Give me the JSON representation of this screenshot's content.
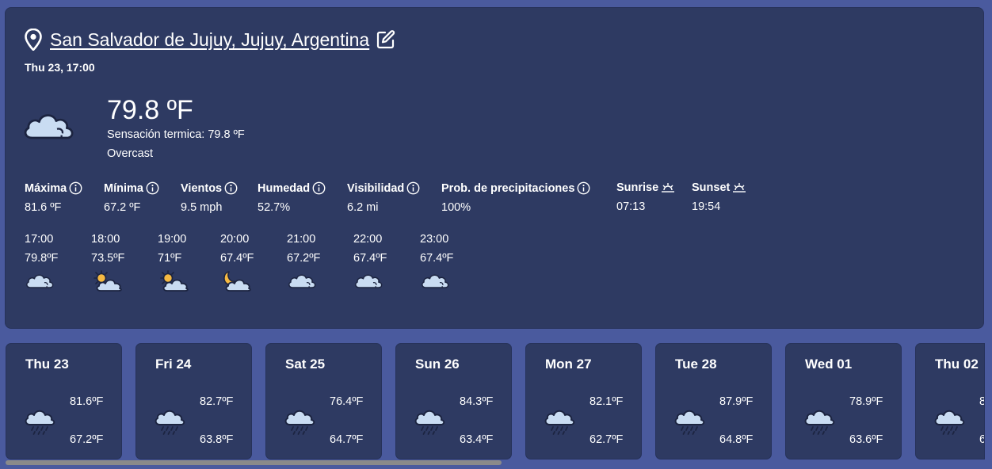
{
  "location": {
    "name": "San Salvador de Jujuy, Jujuy, Argentina"
  },
  "datetime": "Thu 23, 17:00",
  "current": {
    "temp": "79.8 ºF",
    "feels_like": "Sensación termica: 79.8 ºF",
    "condition": "Overcast",
    "icon": "cloud-icon"
  },
  "stats": [
    {
      "label": "Máxima",
      "value": "81.6 ºF",
      "icon": "info-icon"
    },
    {
      "label": "Mínima",
      "value": "67.2 ºF",
      "icon": "info-icon"
    },
    {
      "label": "Vientos",
      "value": "9.5 mph",
      "icon": "info-icon"
    },
    {
      "label": "Humedad",
      "value": "52.7%",
      "icon": "info-icon"
    },
    {
      "label": "Visibilidad",
      "value": "6.2 mi",
      "icon": "info-icon"
    },
    {
      "label": "Prob. de precipitaciones",
      "value": "100%",
      "icon": "info-icon"
    },
    {
      "label": "Sunrise",
      "value": "07:13",
      "icon": "sunrise-icon"
    },
    {
      "label": "Sunset",
      "value": "19:54",
      "icon": "sunset-icon"
    }
  ],
  "hourly": [
    {
      "time": "17:00",
      "temp": "79.8ºF",
      "icon": "cloud-icon"
    },
    {
      "time": "18:00",
      "temp": "73.5ºF",
      "icon": "partly-sunny-icon"
    },
    {
      "time": "19:00",
      "temp": "71ºF",
      "icon": "partly-sunny-icon"
    },
    {
      "time": "20:00",
      "temp": "67.4ºF",
      "icon": "partly-cloudy-night-icon"
    },
    {
      "time": "21:00",
      "temp": "67.2ºF",
      "icon": "cloud-icon"
    },
    {
      "time": "22:00",
      "temp": "67.4ºF",
      "icon": "cloud-icon"
    },
    {
      "time": "23:00",
      "temp": "67.4ºF",
      "icon": "cloud-icon"
    }
  ],
  "daily": [
    {
      "day": "Thu 23",
      "high": "81.6ºF",
      "low": "67.2ºF",
      "icon": "rain-icon"
    },
    {
      "day": "Fri 24",
      "high": "82.7ºF",
      "low": "63.8ºF",
      "icon": "rain-icon"
    },
    {
      "day": "Sat 25",
      "high": "76.4ºF",
      "low": "64.7ºF",
      "icon": "rain-icon"
    },
    {
      "day": "Sun 26",
      "high": "84.3ºF",
      "low": "63.4ºF",
      "icon": "rain-icon"
    },
    {
      "day": "Mon 27",
      "high": "82.1ºF",
      "low": "62.7ºF",
      "icon": "rain-icon"
    },
    {
      "day": "Tue 28",
      "high": "87.9ºF",
      "low": "64.8ºF",
      "icon": "rain-icon"
    },
    {
      "day": "Wed 01",
      "high": "78.9ºF",
      "low": "63.6ºF",
      "icon": "rain-icon"
    },
    {
      "day": "Thu 02",
      "high": "8",
      "low": "6",
      "icon": "rain-icon"
    }
  ],
  "colors": {
    "background": "#4a5a9e",
    "card": "#2e3a62",
    "cloud": "#c9dcf2",
    "sun": "#f5b942"
  }
}
